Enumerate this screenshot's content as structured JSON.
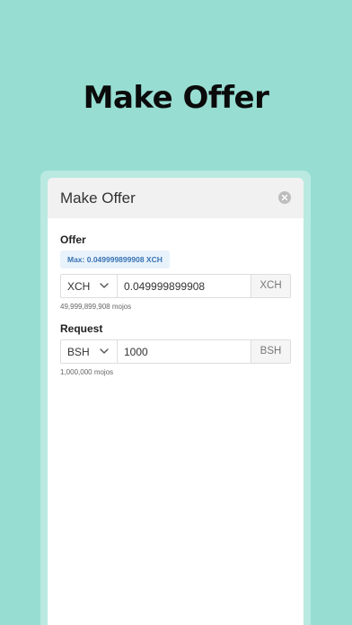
{
  "hero": {
    "title": "Make Offer"
  },
  "modal": {
    "title": "Make Offer",
    "close_icon": "close-icon"
  },
  "offer": {
    "label": "Offer",
    "max_chip": "Max: 0.049999899908 XCH",
    "token": "XCH",
    "amount": "0.049999899908",
    "unit": "XCH",
    "mojos": "49,999,899,908 mojos"
  },
  "request": {
    "label": "Request",
    "token": "BSH",
    "amount": "1000",
    "unit": "BSH",
    "mojos": "1,000,000 mojos"
  },
  "colors": {
    "background": "#97ddd2",
    "chip_text": "#3873b4",
    "chip_bg": "#e8f2fb"
  }
}
